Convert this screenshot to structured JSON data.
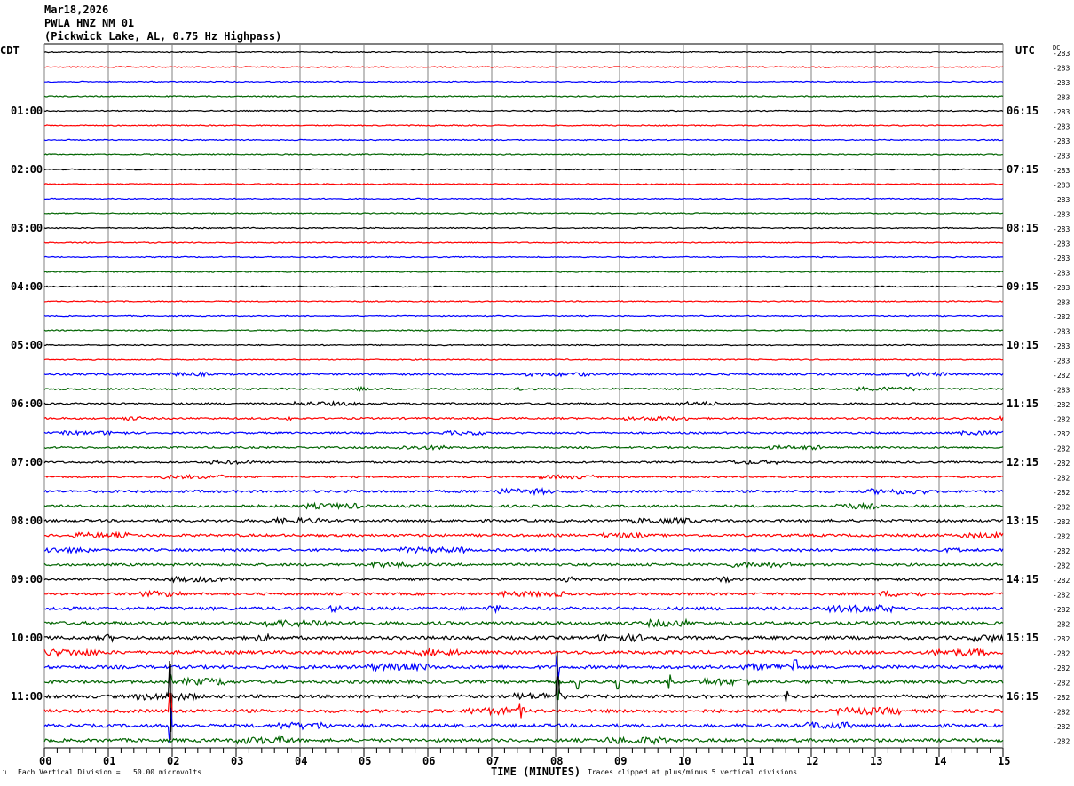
{
  "header": {
    "date": "Mar18,2026",
    "station": "PWLA HNZ NM 01",
    "location": "(Pickwick Lake, AL, 0.75 Hz Highpass)"
  },
  "chart_data": {
    "type": "line",
    "left_timezone": "CDT",
    "right_timezone": "UTC",
    "dc_label": "DC",
    "left_hour_labels": [
      "01:00",
      "02:00",
      "03:00",
      "04:00",
      "05:00",
      "06:00",
      "07:00",
      "08:00",
      "09:00",
      "10:00",
      "11:00"
    ],
    "right_hour_labels": [
      "06:15",
      "07:15",
      "08:15",
      "09:15",
      "10:15",
      "11:15",
      "12:15",
      "13:15",
      "14:15",
      "15:15",
      "16:15"
    ],
    "traces_per_hour": 4,
    "trace_colors": [
      "#000000",
      "#ff0000",
      "#0000ff",
      "#006400"
    ],
    "dc_offsets": [
      "-283",
      "-283",
      "-283",
      "-283",
      "-283",
      "-283",
      "-283",
      "-283",
      "-283",
      "-283",
      "-283",
      "-283",
      "-283",
      "-283",
      "-283",
      "-283",
      "-283",
      "-283",
      "-282",
      "-283",
      "-283",
      "-283",
      "-282",
      "-283",
      "-282",
      "-282",
      "-282",
      "-282",
      "-282",
      "-282",
      "-282",
      "-282",
      "-282",
      "-282",
      "-282",
      "-282",
      "-282",
      "-282",
      "-282",
      "-282",
      "-282",
      "-282",
      "-282",
      "-282",
      "-282",
      "-282",
      "-282",
      "-282"
    ],
    "x_tick_labels": [
      "00",
      "01",
      "02",
      "03",
      "04",
      "05",
      "06",
      "07",
      "08",
      "09",
      "10",
      "11",
      "12",
      "13",
      "14",
      "15"
    ],
    "xlabel": "TIME (MINUTES)",
    "xlim": [
      0,
      15
    ],
    "grid": true,
    "scale_note": "Each Vertical Division =   50.00 microvolts",
    "clip_note": "Traces clipped at plus/minus 5 vertical divisions",
    "corner_mark": "JL"
  }
}
